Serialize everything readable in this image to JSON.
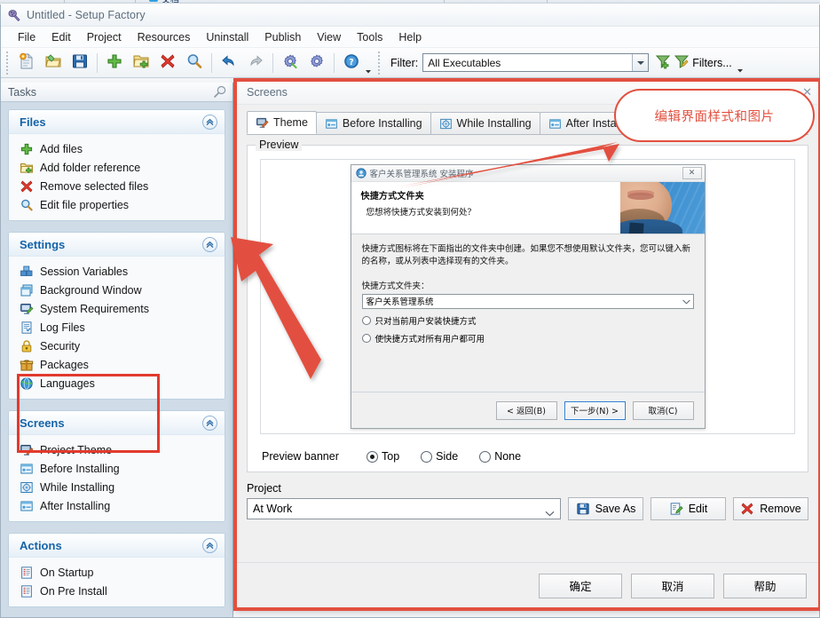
{
  "window": {
    "title": "Untitled - Setup Factory",
    "icon": "setup-factory-icon"
  },
  "menubar": {
    "items": [
      "File",
      "Edit",
      "Project",
      "Resources",
      "Uninstall",
      "Publish",
      "View",
      "Tools",
      "Help"
    ]
  },
  "toolbar": {
    "buttons": [
      {
        "name": "new-project-icon",
        "glyph": "⬜"
      },
      {
        "name": "open-project-icon",
        "glyph": "📂"
      },
      {
        "name": "save-project-icon",
        "glyph": "💾"
      },
      {
        "name": "add-files-icon",
        "glyph": "➕"
      },
      {
        "name": "add-folder-icon",
        "glyph": "📁"
      },
      {
        "name": "remove-files-icon",
        "glyph": "✖"
      },
      {
        "name": "file-properties-icon",
        "glyph": "🔍"
      },
      {
        "name": "undo-icon",
        "glyph": "↶"
      },
      {
        "name": "redo-icon",
        "glyph": "↷"
      },
      {
        "name": "build-settings-icon",
        "glyph": "⚙"
      },
      {
        "name": "build-icon",
        "glyph": "⚙"
      },
      {
        "name": "help-icon",
        "glyph": "?"
      }
    ],
    "filter_label": "Filter:",
    "filter_value": "All Executables",
    "filters_button": "Filters...",
    "add_filter_icon": "add-filter-icon",
    "edit_filter_icon": "edit-filter-icon"
  },
  "taskpane": {
    "header": "Tasks",
    "pin_icon": "pin-icon",
    "panels": [
      {
        "title": "Files",
        "collapse_icon": "chevron-up-icon",
        "items": [
          {
            "label": "Add files",
            "icon": "plus-green-icon"
          },
          {
            "label": "Add folder reference",
            "icon": "folder-add-icon"
          },
          {
            "label": "Remove selected files",
            "icon": "red-x-icon"
          },
          {
            "label": "Edit file properties",
            "icon": "magnifier-icon"
          }
        ]
      },
      {
        "title": "Settings",
        "collapse_icon": "chevron-up-icon",
        "items": [
          {
            "label": "Session Variables",
            "icon": "session-variables-icon"
          },
          {
            "label": "Background Window",
            "icon": "background-window-icon"
          },
          {
            "label": "System Requirements",
            "icon": "system-requirements-icon"
          },
          {
            "label": "Log Files",
            "icon": "log-files-icon"
          },
          {
            "label": "Security",
            "icon": "lock-icon"
          },
          {
            "label": "Packages",
            "icon": "package-icon"
          },
          {
            "label": "Languages",
            "icon": "globe-icon"
          }
        ]
      },
      {
        "title": "Screens",
        "collapse_icon": "chevron-up-icon",
        "items": [
          {
            "label": "Project Theme",
            "icon": "project-theme-icon"
          },
          {
            "label": "Before Installing",
            "icon": "screen-icon"
          },
          {
            "label": "While Installing",
            "icon": "progress-icon"
          },
          {
            "label": "After Installing",
            "icon": "screen-icon"
          }
        ]
      },
      {
        "title": "Actions",
        "collapse_icon": "chevron-up-icon",
        "items": [
          {
            "label": "On Startup",
            "icon": "script-icon"
          },
          {
            "label": "On Pre Install",
            "icon": "script-icon"
          }
        ]
      }
    ]
  },
  "dialog": {
    "title": "Screens",
    "tabs": [
      {
        "label": "Theme",
        "icon": "project-theme-icon",
        "active": true
      },
      {
        "label": "Before Installing",
        "icon": "screen-icon",
        "active": false
      },
      {
        "label": "While Installing",
        "icon": "progress-icon",
        "active": false
      },
      {
        "label": "After Installing",
        "icon": "screen-icon",
        "active": false
      }
    ],
    "preview_group_label": "Preview",
    "banner_row": {
      "label": "Preview banner",
      "options": [
        {
          "label": "Top",
          "selected": true
        },
        {
          "label": "Side",
          "selected": false
        },
        {
          "label": "None",
          "selected": false
        }
      ]
    },
    "project": {
      "label": "Project",
      "value": "At Work",
      "buttons": [
        {
          "label": "Save As",
          "icon": "save-icon"
        },
        {
          "label": "Edit",
          "icon": "edit-icon"
        },
        {
          "label": "Remove",
          "icon": "red-x-icon"
        }
      ]
    },
    "footer_buttons": [
      {
        "label": "确定",
        "name": "ok-button"
      },
      {
        "label": "取消",
        "name": "cancel-button"
      },
      {
        "label": "帮助",
        "name": "help-button"
      }
    ]
  },
  "installer_preview": {
    "title": "客户关系管理系统 安装程序",
    "close_glyph": "✕",
    "heading": "快捷方式文件夹",
    "subheading": "您想将快捷方式安装到何处？",
    "body_text": "快捷方式图标将在下面指出的文件夹中创建。如果您不想使用默认文件夹，您可以键入新的名称，或从列表中选择现有的文件夹。",
    "field_label": "快捷方式文件夹：",
    "field_value": "客户关系管理系统",
    "radios": [
      {
        "label": "只对当前用户安装快捷方式",
        "selected": false
      },
      {
        "label": "使快捷方式对所有用户都可用",
        "selected": false
      }
    ],
    "buttons": [
      {
        "label": "< 返回(B)",
        "default": false
      },
      {
        "label": "下一步(N) >",
        "default": true
      },
      {
        "label": "取消(C)",
        "default": false
      }
    ]
  },
  "annotation": {
    "callout_text": "编辑界面样式和图片",
    "accent_color": "#e2503f"
  }
}
